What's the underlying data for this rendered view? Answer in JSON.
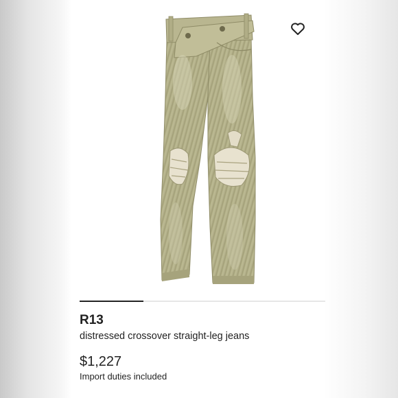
{
  "product": {
    "brand": "R13",
    "description": "distressed crossover straight-leg jeans",
    "price": "$1,227",
    "duties_note": "Import duties included",
    "image_alt": "distressed crossover straight-leg jeans",
    "wishlist_icon": "heart-outline-icon"
  },
  "carousel": {
    "current_slide_fraction": 0.26
  },
  "colors": {
    "text": "#222222",
    "denim": "#b7b48d",
    "progress": "#222222",
    "track": "#e6e6e6"
  }
}
